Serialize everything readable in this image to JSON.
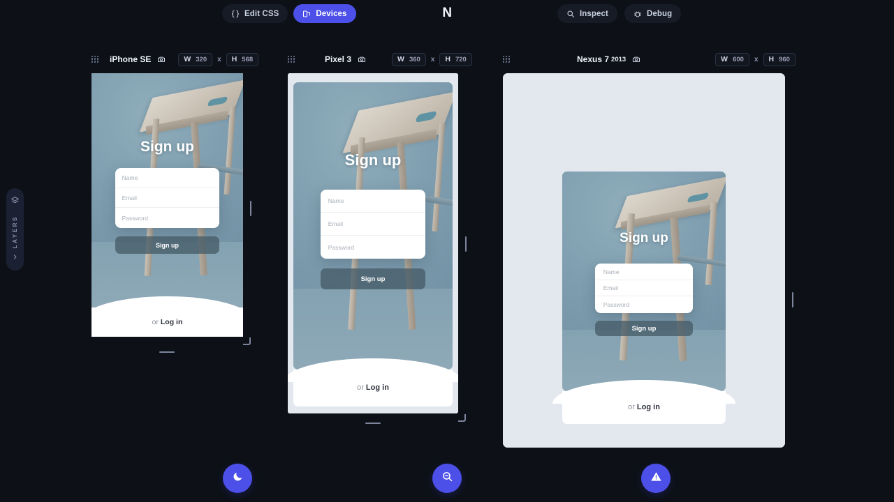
{
  "app": {
    "brand": "N",
    "background": "#0d1117",
    "accent": "#4c50e8"
  },
  "toolbar": {
    "left_buttons": [
      {
        "id": "edit-css",
        "label": "Edit CSS",
        "icon": "braces-icon",
        "active": false
      },
      {
        "id": "devices",
        "label": "Devices",
        "icon": "devices-icon",
        "active": true
      }
    ],
    "right_buttons": [
      {
        "id": "inspect",
        "label": "Inspect",
        "icon": "search-icon",
        "active": false
      },
      {
        "id": "debug",
        "label": "Debug",
        "icon": "bug-icon",
        "active": false
      }
    ]
  },
  "sidebar": {
    "label": "LAYERS",
    "icon": "layers-icon",
    "expand_icon": "chevron-right-icon"
  },
  "devices": [
    {
      "id": "iphone-se",
      "name": "iPhone SE",
      "year": "",
      "width_key": "W",
      "width_value": "320",
      "separator": "x",
      "height_key": "H",
      "height_value": "568",
      "grip_icon": "drag-grid-icon",
      "camera_icon": "camera-icon"
    },
    {
      "id": "pixel-3",
      "name": "Pixel 3",
      "year": "",
      "width_key": "W",
      "width_value": "360",
      "separator": "x",
      "height_key": "H",
      "height_value": "720",
      "grip_icon": "drag-grid-icon",
      "camera_icon": "camera-icon"
    },
    {
      "id": "nexus-7",
      "name": "Nexus 7",
      "year": "2013",
      "width_key": "W",
      "width_value": "600",
      "separator": "x",
      "height_key": "H",
      "height_value": "960",
      "grip_icon": "drag-grid-icon",
      "camera_icon": "camera-icon"
    }
  ],
  "page": {
    "title": "Sign up",
    "fields": [
      {
        "id": "name",
        "placeholder": "Name",
        "value": ""
      },
      {
        "id": "email",
        "placeholder": "Email",
        "value": ""
      },
      {
        "id": "password",
        "placeholder": "Password",
        "value": ""
      }
    ],
    "submit_label": "Sign up",
    "footer_prefix": "or",
    "footer_link": "Log in",
    "image_alt": "wooden-stool-photo"
  },
  "fabs": [
    {
      "id": "dark-mode",
      "icon": "moon-icon"
    },
    {
      "id": "zoom-out",
      "icon": "zoom-out-icon"
    },
    {
      "id": "warning",
      "icon": "warning-triangle-icon"
    }
  ]
}
